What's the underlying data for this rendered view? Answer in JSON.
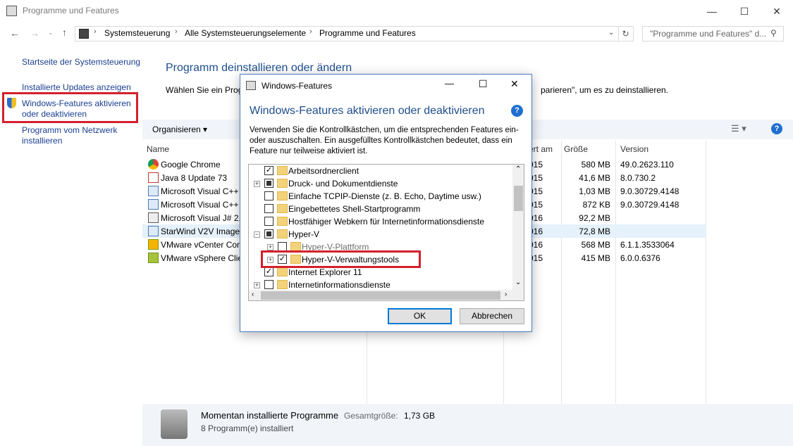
{
  "window": {
    "title": "Programme und Features"
  },
  "address": {
    "crumbs": [
      "Systemsteuerung",
      "Alle Systemsteuerungselemente",
      "Programme und Features"
    ],
    "search_placeholder": "\"Programme und Features\" d..."
  },
  "sidebar": {
    "items": [
      {
        "label": "Startseite der Systemsteuerung"
      },
      {
        "label": "Installierte Updates anzeigen"
      },
      {
        "label": "Windows-Features aktivieren oder deaktivieren"
      },
      {
        "label": "Programm vom Netzwerk installieren"
      }
    ]
  },
  "main": {
    "title": "Programm deinstallieren oder ändern",
    "desc_left": "Wählen Sie ein Prog",
    "desc_right": "parieren\", um es zu deinstallieren."
  },
  "toolbar": {
    "organize": "Organisieren"
  },
  "columns": {
    "name": "Name",
    "installed": "ert am",
    "size": "Größe",
    "version": "Version"
  },
  "programs": [
    {
      "name": "Google Chrome",
      "date": "015",
      "size": "580 MB",
      "version": "49.0.2623.110"
    },
    {
      "name": "Java 8 Update 73",
      "date": "015",
      "size": "41,6 MB",
      "version": "8.0.730.2"
    },
    {
      "name": "Microsoft Visual C++",
      "date": "015",
      "size": "1,03 MB",
      "version": "9.0.30729.4148"
    },
    {
      "name": "Microsoft Visual C++",
      "date": "015",
      "size": "872 KB",
      "version": "9.0.30729.4148"
    },
    {
      "name": "Microsoft Visual J# 2.",
      "date": "016",
      "size": "92,2 MB",
      "version": ""
    },
    {
      "name": "StarWind V2V Image C",
      "date": "016",
      "size": "72,8 MB",
      "version": ""
    },
    {
      "name": "VMware vCenter Con",
      "date": "016",
      "size": "568 MB",
      "version": "6.1.1.3533064"
    },
    {
      "name": "VMware vSphere Clie",
      "date": "015",
      "size": "415 MB",
      "version": "6.0.0.6376"
    }
  ],
  "status": {
    "title": "Momentan installierte Programme",
    "total_label": "Gesamtgröße:",
    "total_value": "1,73 GB",
    "count": "8 Programm(e) installiert"
  },
  "dialog": {
    "title": "Windows-Features",
    "heading": "Windows-Features aktivieren oder deaktivieren",
    "description": "Verwenden Sie die Kontrollkästchen, um die entsprechenden Features ein- oder auszuschalten. Ein ausgefülltes Kontrollkästchen bedeutet, dass ein Feature nur teilweise aktiviert ist.",
    "features": [
      {
        "label": "Arbeitsordnerclient",
        "state": "checked",
        "expand": "",
        "level": 0
      },
      {
        "label": "Druck- und Dokumentdienste",
        "state": "partial",
        "expand": "+",
        "level": 0
      },
      {
        "label": "Einfache TCPIP-Dienste (z. B. Echo, Daytime usw.)",
        "state": "unchecked",
        "expand": "",
        "level": 0
      },
      {
        "label": "Eingebettetes Shell-Startprogramm",
        "state": "unchecked",
        "expand": "",
        "level": 0
      },
      {
        "label": "Hostfähiger Webkern für Internetinformationsdienste",
        "state": "unchecked",
        "expand": "",
        "level": 0
      },
      {
        "label": "Hyper-V",
        "state": "partial",
        "expand": "−",
        "level": 0
      },
      {
        "label": "Hyper-V-Plattform",
        "state": "unchecked",
        "expand": "+",
        "level": 1,
        "dim": true
      },
      {
        "label": "Hyper-V-Verwaltungstools",
        "state": "checked",
        "expand": "+",
        "level": 1
      },
      {
        "label": "Internet Explorer 11",
        "state": "checked",
        "expand": "",
        "level": 0
      },
      {
        "label": "Internetinformationsdienste",
        "state": "unchecked",
        "expand": "+",
        "level": 0
      }
    ],
    "ok": "OK",
    "cancel": "Abbrechen"
  },
  "colors": {
    "link": "#1a3f8f",
    "heading": "#1e4e8c",
    "highlight": "#d4202c",
    "selected_row": "#e5f1fb"
  }
}
